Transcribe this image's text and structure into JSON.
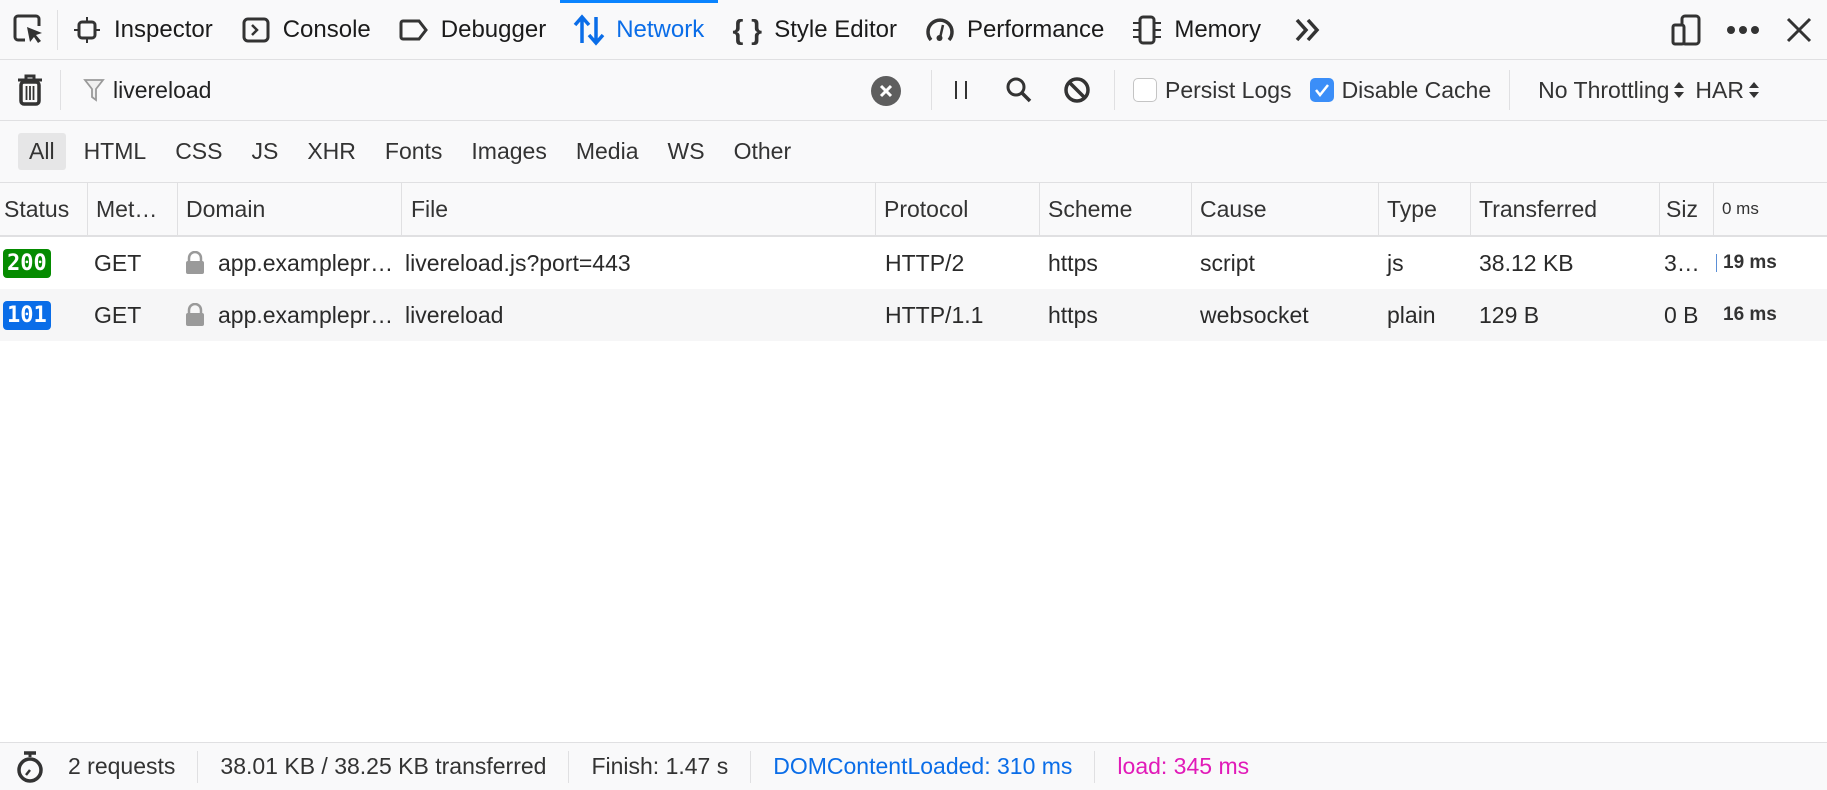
{
  "tabs": [
    {
      "label": "Inspector",
      "icon": "inspector-icon",
      "selected": false
    },
    {
      "label": "Console",
      "icon": "console-icon",
      "selected": false
    },
    {
      "label": "Debugger",
      "icon": "debugger-icon",
      "selected": false
    },
    {
      "label": "Network",
      "icon": "network-icon",
      "selected": true
    },
    {
      "label": "Style Editor",
      "icon": "style-editor-icon",
      "selected": false
    },
    {
      "label": "Performance",
      "icon": "performance-icon",
      "selected": false
    },
    {
      "label": "Memory",
      "icon": "memory-icon",
      "selected": false
    }
  ],
  "toolbar": {
    "filter_value": "livereload",
    "persist_logs_label": "Persist Logs",
    "persist_logs_checked": false,
    "disable_cache_label": "Disable Cache",
    "disable_cache_checked": true,
    "throttling": "No Throttling",
    "har": "HAR"
  },
  "type_filters": [
    "All",
    "HTML",
    "CSS",
    "JS",
    "XHR",
    "Fonts",
    "Images",
    "Media",
    "WS",
    "Other"
  ],
  "active_type_filter": "All",
  "table": {
    "columns": [
      "Status",
      "Met…",
      "Domain",
      "File",
      "Protocol",
      "Scheme",
      "Cause",
      "Type",
      "Transferred",
      "Siz",
      "0 ms"
    ],
    "rows": [
      {
        "status": "200",
        "status_color": "#058b00",
        "method": "GET",
        "domain": "app.examplepr…",
        "file": "livereload.js?port=443",
        "protocol": "HTTP/2",
        "scheme": "https",
        "cause": "script",
        "type": "js",
        "transferred": "38.12 KB",
        "size": "3…",
        "timing": "19 ms"
      },
      {
        "status": "101",
        "status_color": "#0a6de8",
        "method": "GET",
        "domain": "app.examplepr…",
        "file": "livereload",
        "protocol": "HTTP/1.1",
        "scheme": "https",
        "cause": "websocket",
        "type": "plain",
        "transferred": "129 B",
        "size": "0 B",
        "timing": "16 ms"
      }
    ]
  },
  "statusbar": {
    "requests": "2 requests",
    "transferred": "38.01 KB / 38.25 KB transferred",
    "finish": "Finish: 1.47 s",
    "dom_content_loaded": "DOMContentLoaded: 310 ms",
    "load": "load: 345 ms"
  },
  "colors": {
    "accent": "#0a84ff",
    "dom_content_loaded": "#0a6de8",
    "load": "#e11ab8"
  }
}
